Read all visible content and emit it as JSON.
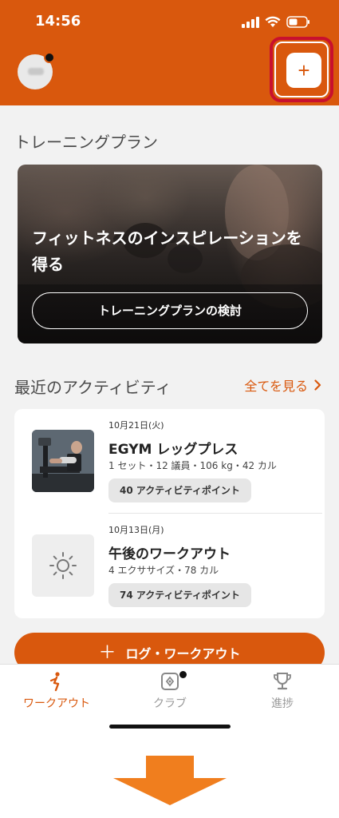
{
  "status_bar": {
    "time": "14:56"
  },
  "header": {
    "add_label": "+"
  },
  "training_plan": {
    "section_title": "トレーニングプラン",
    "hero_text": "フィットネスのインスピレーションを得る",
    "hero_button": "トレーニングプランの検討"
  },
  "recent": {
    "section_title": "最近のアクティビティ",
    "see_all": "全てを見る",
    "items": [
      {
        "date": "10月21日(火)",
        "title": "EGYM レッグプレス",
        "meta": "1 セット・12 議員・106 kg・42 カル",
        "badge": "40 アクティビティポイント"
      },
      {
        "date": "10月13日(月)",
        "title": "午後のワークアウト",
        "meta": "4 エクササイズ・78 カル",
        "badge": "74 アクティビティポイント"
      }
    ]
  },
  "log_workout": {
    "label": "ログ・ワークアウト"
  },
  "tabs": [
    {
      "label": "ワークアウト",
      "icon": "workout-icon",
      "active": true
    },
    {
      "label": "クラブ",
      "icon": "club-icon",
      "active": false
    },
    {
      "label": "進捗",
      "icon": "trophy-icon",
      "active": false
    }
  ],
  "colors": {
    "accent": "#d9580d",
    "highlight": "#c8102e",
    "arrow": "#f07e1e"
  }
}
